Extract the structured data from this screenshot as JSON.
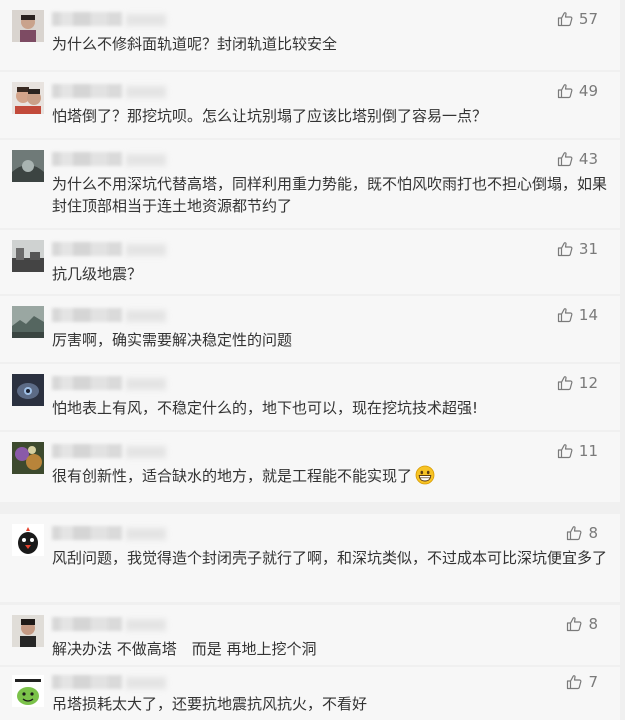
{
  "comments": [
    {
      "text": "为什么不修斜面轨道呢？封闭轨道比较安全",
      "likes": "57"
    },
    {
      "text": "怕塔倒了？那挖坑呗。怎么让坑别塌了应该比塔别倒了容易一点？",
      "likes": "49"
    },
    {
      "text": "为什么不用深坑代替高塔，同样利用重力势能，既不怕风吹雨打也不担心倒塌，如果封住顶部相当于连土地资源都节约了",
      "likes": "43"
    },
    {
      "text": "抗几级地震？",
      "likes": "31"
    },
    {
      "text": "厉害啊，确实需要解决稳定性的问题",
      "likes": "14"
    },
    {
      "text": "怕地表上有风，不稳定什么的，地下也可以，现在挖坑技术超强!",
      "likes": "12"
    },
    {
      "text": "很有创新性，适合缺水的地方，就是工程能不能实现了",
      "likes": "11",
      "emoji": "grinning-face-icon"
    },
    {
      "text": "风刮问题，我觉得造个封闭壳子就行了啊，和深坑类似，不过成本可比深坑便宜多了",
      "likes": "8"
    },
    {
      "text": "解决办法 不做高塔　而是 再地上挖个洞",
      "likes": "8"
    },
    {
      "text": "吊塔损耗太大了，还要抗地震抗风抗火，不看好",
      "likes": "7"
    }
  ],
  "colors": {
    "background": "#f0f0f0",
    "card": "#f7f7f7",
    "text": "#333333",
    "like": "#7a7a7a"
  },
  "icons": {
    "like": "thumbs-up-icon"
  }
}
